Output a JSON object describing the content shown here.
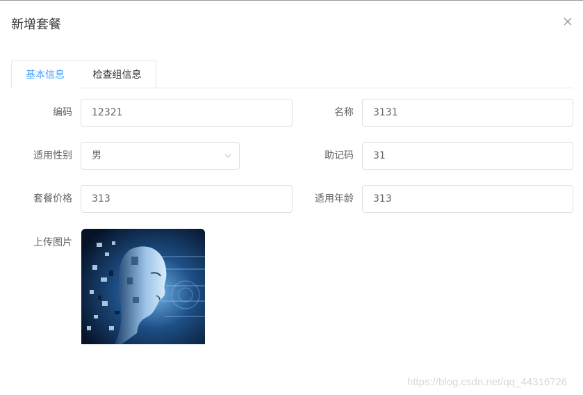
{
  "dialog": {
    "title": "新增套餐"
  },
  "tabs": [
    {
      "label": "基本信息",
      "active": true
    },
    {
      "label": "检查组信息",
      "active": false
    }
  ],
  "form": {
    "code": {
      "label": "编码",
      "value": "12321"
    },
    "name": {
      "label": "名称",
      "value": "3131"
    },
    "sex": {
      "label": "适用性别",
      "value": "男"
    },
    "helpcode": {
      "label": "助记码",
      "value": "31"
    },
    "price": {
      "label": "套餐价格",
      "value": "313"
    },
    "age": {
      "label": "适用年龄",
      "value": "313"
    },
    "image": {
      "label": "上传图片"
    }
  },
  "watermark": "https://blog.csdn.net/qq_44316726",
  "colors": {
    "accent": "#409eff",
    "border": "#dcdfe6",
    "text": "#606266",
    "title": "#303133"
  },
  "icons": {
    "close": "close-icon",
    "select": "chevron-down-icon"
  }
}
